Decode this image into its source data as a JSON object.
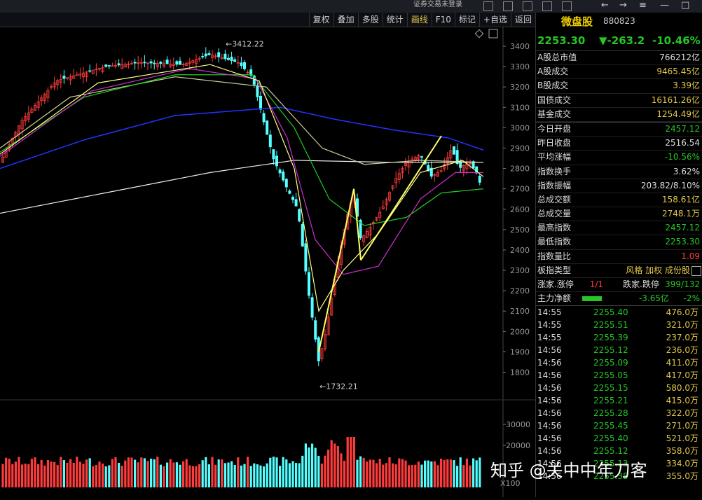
{
  "topbar": {
    "title": "证券交易未登录"
  },
  "toolbar": {
    "tabs": [
      {
        "label": "复权"
      },
      {
        "label": "叠加"
      },
      {
        "label": "多股"
      },
      {
        "label": "统计"
      },
      {
        "label": "画线"
      },
      {
        "label": "F10"
      },
      {
        "label": "标记"
      },
      {
        "label": "+自选"
      },
      {
        "label": "返回"
      }
    ]
  },
  "chart": {
    "price_axis": [
      "3400",
      "3300",
      "3200",
      "3100",
      "3000",
      "2900",
      "2800",
      "2700",
      "2600",
      "2500",
      "2400",
      "2300",
      "2200",
      "2100",
      "2000",
      "1900",
      "1800"
    ],
    "high_label": "3412.22",
    "low_label": "1732.21",
    "vol_axis": [
      "30000",
      "20000"
    ],
    "vol_unit": "X100"
  },
  "panel": {
    "name": "微盘股",
    "code": "880823",
    "price": "2253.30",
    "change": "▼-263.2",
    "change_pct": "-10.46%",
    "stats_a": [
      {
        "k": "A股总市值",
        "v": "766212亿",
        "c": "w"
      },
      {
        "k": "A股成交",
        "v": "9465.45亿",
        "c": "y"
      },
      {
        "k": "B股成交",
        "v": "3.39亿",
        "c": "y"
      },
      {
        "k": "国债成交",
        "v": "16161.26亿",
        "c": "y"
      },
      {
        "k": "基金成交",
        "v": "1254.49亿",
        "c": "y"
      }
    ],
    "stats_b": [
      {
        "k": "今日开盘",
        "v": "2457.12",
        "c": "g"
      },
      {
        "k": "昨日收盘",
        "v": "2516.54",
        "c": "w"
      },
      {
        "k": "平均涨幅",
        "v": "-10.56%",
        "c": "g"
      },
      {
        "k": "指数换手",
        "v": "3.62%",
        "c": "w"
      },
      {
        "k": "指数振幅",
        "v": "203.82/8.10%",
        "c": "w"
      },
      {
        "k": "总成交额",
        "v": "158.61亿",
        "c": "y"
      },
      {
        "k": "总成交量",
        "v": "2748.1万",
        "c": "y"
      },
      {
        "k": "最高指数",
        "v": "2457.12",
        "c": "g"
      },
      {
        "k": "最低指数",
        "v": "2253.30",
        "c": "g"
      },
      {
        "k": "指数量比",
        "v": "1.09",
        "c": "r"
      }
    ],
    "type_row": {
      "k": "板指类型",
      "v": "风格 加权 成份股"
    },
    "adv_row": {
      "k": "涨家.涨停",
      "v1": "1/1",
      "k2": "跌家.跌停",
      "v2": "399/132"
    },
    "flow_row": {
      "k": "主力净额",
      "v1": "-3.65亿",
      "v2": "-2%"
    },
    "trades": [
      {
        "t": "14:55",
        "p": "2255.40",
        "v": "476.0万"
      },
      {
        "t": "14:55",
        "p": "2255.51",
        "v": "321.0万"
      },
      {
        "t": "14:55",
        "p": "2255.39",
        "v": "237.0万"
      },
      {
        "t": "14:56",
        "p": "2255.12",
        "v": "236.0万"
      },
      {
        "t": "14:56",
        "p": "2255.09",
        "v": "411.0万"
      },
      {
        "t": "14:56",
        "p": "2255.05",
        "v": "417.0万"
      },
      {
        "t": "14:56",
        "p": "2255.15",
        "v": "580.0万"
      },
      {
        "t": "14:56",
        "p": "2255.21",
        "v": "415.0万"
      },
      {
        "t": "14:56",
        "p": "2255.28",
        "v": "322.0万"
      },
      {
        "t": "14:56",
        "p": "2255.45",
        "v": "271.0万"
      },
      {
        "t": "14:56",
        "p": "2255.40",
        "v": "521.0万"
      },
      {
        "t": "14:56",
        "p": "2255.12",
        "v": "358.0万"
      },
      {
        "t": "14:56",
        "p": "2255.13",
        "v": "334.0万"
      },
      {
        "t": "14:56",
        "p": "2255.35",
        "v": "355.0万"
      }
    ]
  },
  "watermark": "知乎 @关中中年刀客"
}
